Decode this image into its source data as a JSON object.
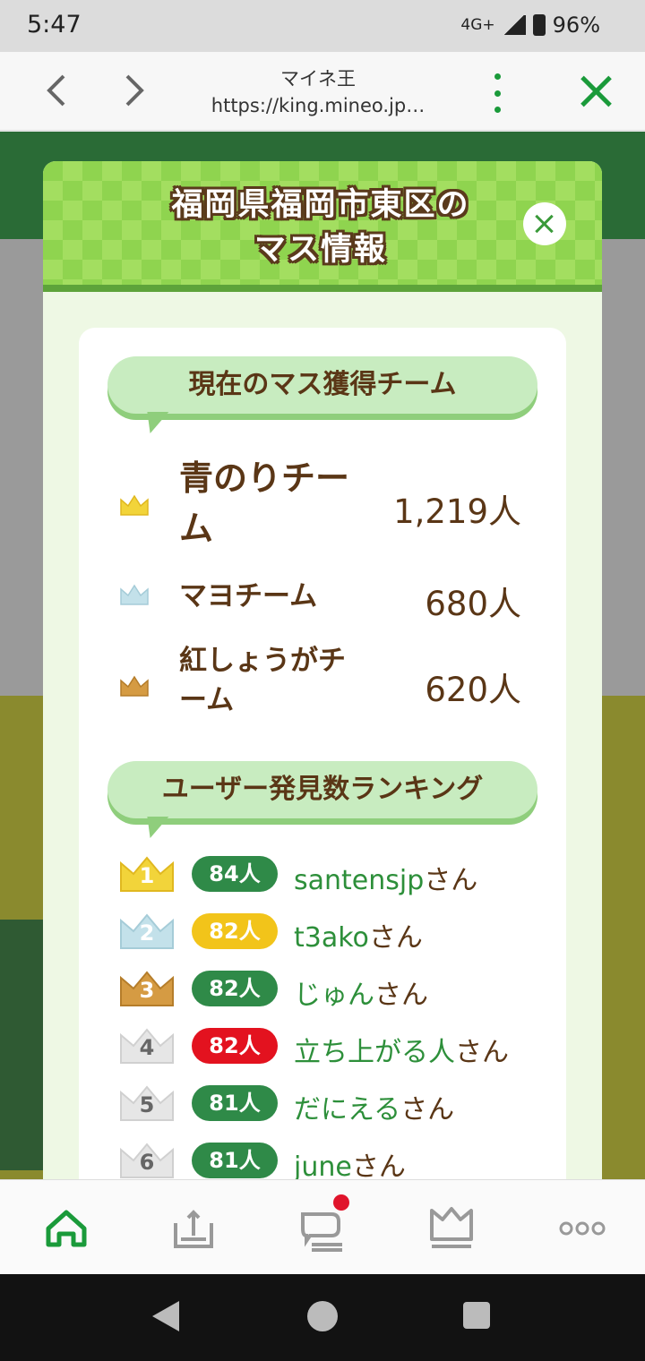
{
  "status_bar": {
    "time": "5:47",
    "network": "4G+",
    "battery": "96%"
  },
  "browser": {
    "title": "マイネ王",
    "url": "https://king.mineo.jp…"
  },
  "modal": {
    "title_line1": "福岡県福岡市東区の",
    "title_line2": "マス情報",
    "current_section_title": "現在のマス獲得チーム",
    "teams": [
      {
        "name": "青のりチーム",
        "count": "1,219人",
        "crown_color": "#f2d43a"
      },
      {
        "name": "マヨチーム",
        "count": "680人",
        "crown_color": "#c3e1ea"
      },
      {
        "name": "紅しょうがチーム",
        "count": "620人",
        "crown_color": "#d59b43"
      }
    ],
    "ranking_section_title": "ユーザー発見数ランキング",
    "ranking": [
      {
        "rank": "1",
        "count": "84人",
        "name": "santensjp",
        "suffix": "さん",
        "badge_color": "#2f8a48",
        "crown_color": "#f2d43a"
      },
      {
        "rank": "2",
        "count": "82人",
        "name": "t3ako",
        "suffix": "さん",
        "badge_color": "#f2c41a",
        "crown_color": "#c3e1ea"
      },
      {
        "rank": "3",
        "count": "82人",
        "name": "じゅん",
        "suffix": "さん",
        "badge_color": "#2f8a48",
        "crown_color": "#d59b43"
      },
      {
        "rank": "4",
        "count": "82人",
        "name": "立ち上がる人",
        "suffix": "さん",
        "badge_color": "#e3121f",
        "crown_color": "#e6e6e6"
      },
      {
        "rank": "5",
        "count": "81人",
        "name": "だにえる",
        "suffix": "さん",
        "badge_color": "#2f8a48",
        "crown_color": "#e6e6e6"
      },
      {
        "rank": "6",
        "count": "81人",
        "name": "june",
        "suffix": "さん",
        "badge_color": "#2f8a48",
        "crown_color": "#e6e6e6"
      }
    ]
  },
  "bottom_nav": [
    {
      "icon": "home-icon",
      "active": true
    },
    {
      "icon": "upload-icon",
      "active": false
    },
    {
      "icon": "chat-icon",
      "active": false,
      "notification": true
    },
    {
      "icon": "crown-icon",
      "active": false
    },
    {
      "icon": "more-icon",
      "active": false
    }
  ],
  "colors": {
    "accent_green": "#1a9a3a",
    "brown_text": "#5a3616"
  }
}
